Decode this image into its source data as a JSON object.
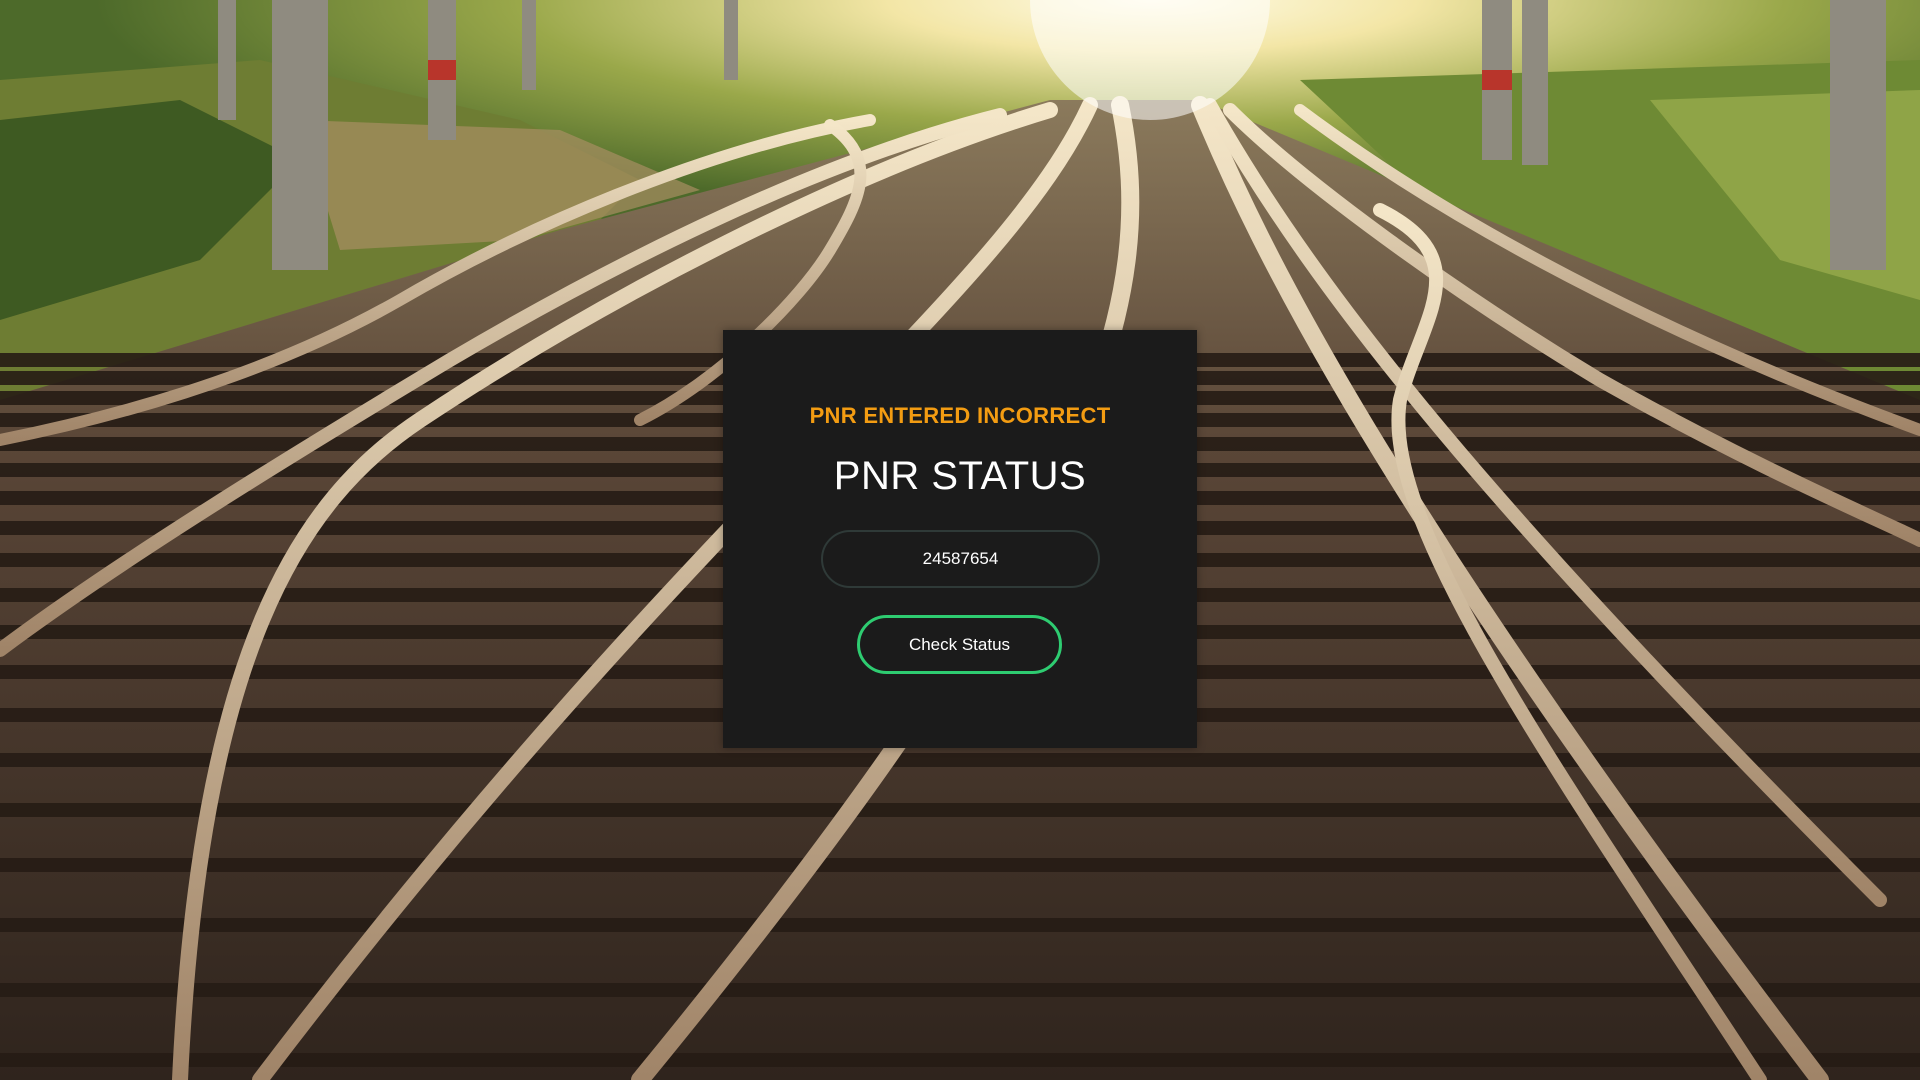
{
  "background": {
    "scene": "railway-tracks-junction-photo",
    "colors": {
      "sky": "#f6ecc0",
      "grass": "#7a8f3a",
      "ballast": "#3d3128",
      "rail": "#b9a58f",
      "sleeper": "#2a1f18"
    }
  },
  "card": {
    "error_message": "PNR ENTERED INCORRECT",
    "title": "PNR STATUS",
    "pnr_input": {
      "value": "24587654",
      "placeholder": ""
    },
    "check_button_label": "Check Status"
  },
  "colors": {
    "card_bg": "#1b1b1b",
    "error": "#f39c12",
    "button_border": "#2ecc71",
    "text": "#ffffff"
  }
}
